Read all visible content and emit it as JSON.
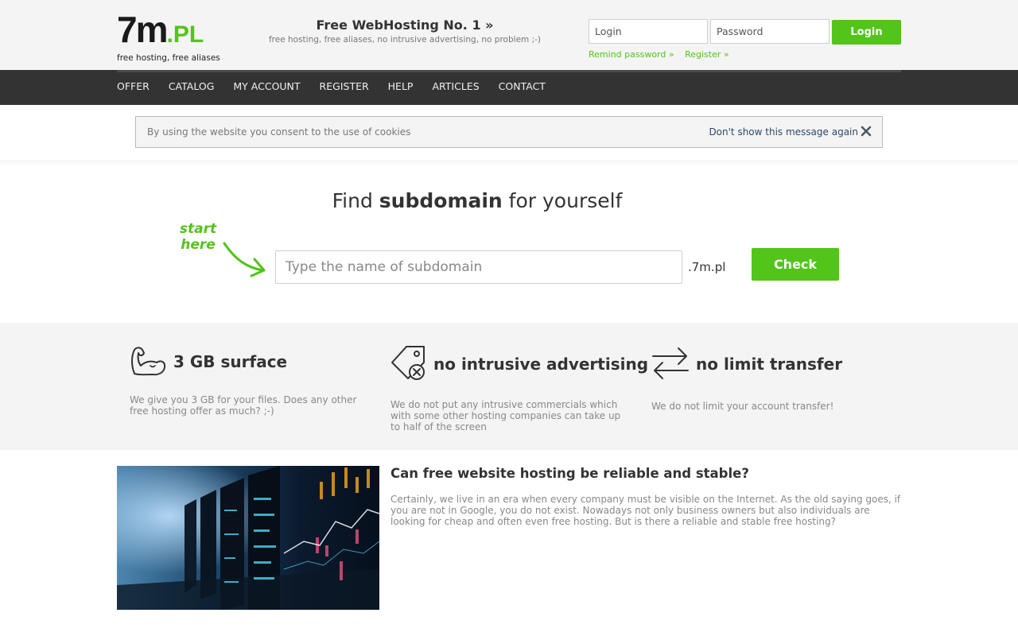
{
  "header": {
    "logo": {
      "mark": "7m",
      "mark_suffix": ".PL",
      "tagline": "free hosting, free aliases"
    },
    "promo": {
      "title": "Free WebHosting No. 1 »",
      "subtitle": "free hosting, free aliases, no intrusive advertising, no problem ;-)"
    },
    "login": {
      "login_placeholder": "Login",
      "password_placeholder": "Password",
      "button_label": "Login",
      "remind_link": "Remind password »",
      "register_link": "Register »"
    }
  },
  "nav": {
    "items": [
      "OFFER",
      "CATALOG",
      "MY ACCOUNT",
      "REGISTER",
      "HELP",
      "ARTICLES",
      "CONTACT"
    ]
  },
  "cookie": {
    "text": "By using the website you consent to the use of cookies",
    "dismiss": "Don't show this message again"
  },
  "search": {
    "title_prefix": "Find ",
    "title_bold": "subdomain",
    "title_suffix": " for yourself",
    "hint": [
      "start",
      "here"
    ],
    "placeholder": "Type the name of subdomain",
    "suffix": ".7m.pl",
    "button_label": "Check"
  },
  "features": [
    {
      "icon": "muscle-arm-icon",
      "title": "3 GB surface",
      "desc": "We give you 3 GB for your files. Does any other free hosting offer as much? ;-)"
    },
    {
      "icon": "price-tag-no-icon",
      "title": "no intrusive advertising",
      "desc": "We do not put any intrusive commercials which with some other hosting companies can take up to half of the screen"
    },
    {
      "icon": "transfer-arrows-icon",
      "title": "no limit transfer",
      "desc": "We do not limit your account transfer!"
    }
  ],
  "article": {
    "title": "Can free website hosting be reliable and stable?",
    "text": "Certainly, we live in an era when every company must be visible on the Internet. As the old saying goes, if you are not in Google, you do not exist. Nowadays not only business owners but also individuals are looking for cheap and often even free hosting. But is there a reliable and stable free hosting?"
  },
  "colors": {
    "accent": "#52c41a",
    "nav_bg": "#333333",
    "header_bg": "#f4f4f4"
  }
}
